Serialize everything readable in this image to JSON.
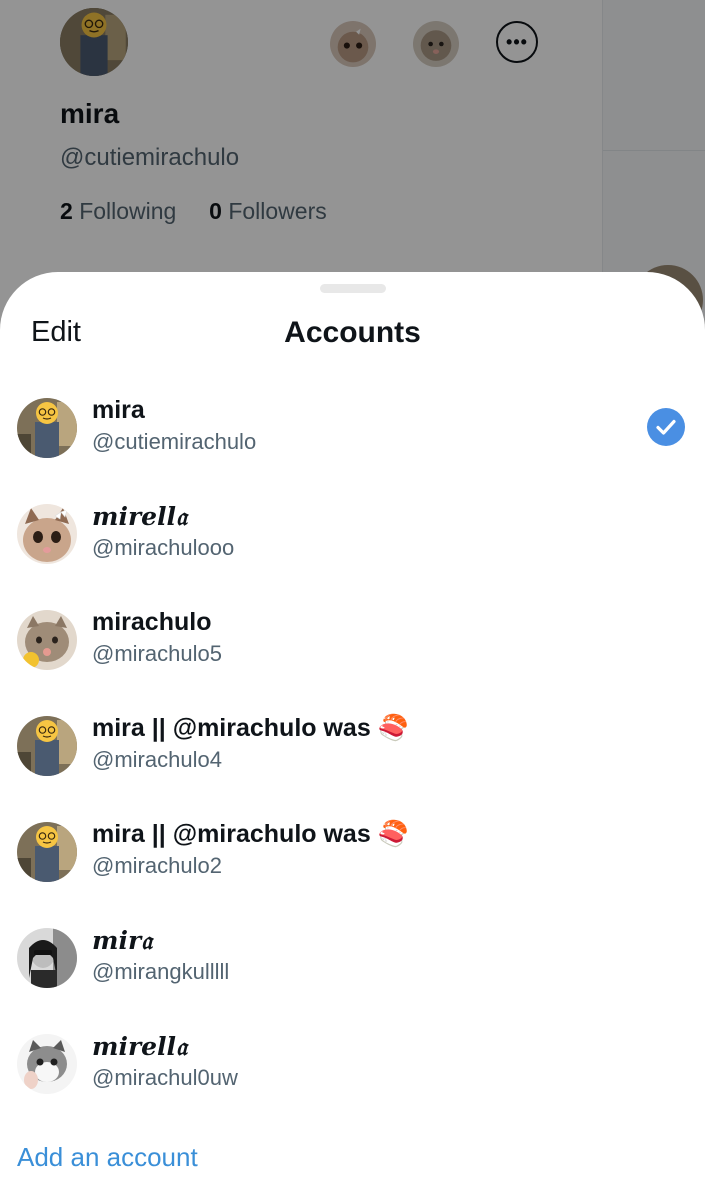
{
  "background_profile": {
    "name": "mira",
    "handle": "@cutiemirachulo",
    "following_count": "2",
    "following_label": "Following",
    "followers_count": "0",
    "followers_label": "Followers",
    "more_label": "•••"
  },
  "sheet": {
    "edit_label": "Edit",
    "title": "Accounts",
    "add_account_label": "Add an account"
  },
  "accounts": [
    {
      "name": "mira",
      "handle": "@cutiemirachulo",
      "avatar": "person-emoji-face",
      "selected": true
    },
    {
      "name": "mirell𝔞",
      "handle": "@mirachulooo",
      "avatar": "kitten-bow",
      "selected": false
    },
    {
      "name": "mirachulo",
      "handle": "@mirachulo5",
      "avatar": "cat-photo",
      "selected": false
    },
    {
      "name": "mira || @mirachulo was 🍣",
      "handle": "@mirachulo4",
      "avatar": "person-emoji-face",
      "selected": false
    },
    {
      "name": "mira || @mirachulo was 🍣",
      "handle": "@mirachulo2",
      "avatar": "person-emoji-face",
      "selected": false
    },
    {
      "name": "mir𝔞",
      "handle": "@mirangkulllll",
      "avatar": "bw-selfie",
      "selected": false
    },
    {
      "name": "mirell𝔞",
      "handle": "@mirachul0uw",
      "avatar": "kitten-paw",
      "selected": false
    }
  ],
  "colors": {
    "accent": "#4a8fe3",
    "link": "#3a8fd8",
    "text_primary": "#0f1419",
    "text_secondary": "#536471"
  }
}
